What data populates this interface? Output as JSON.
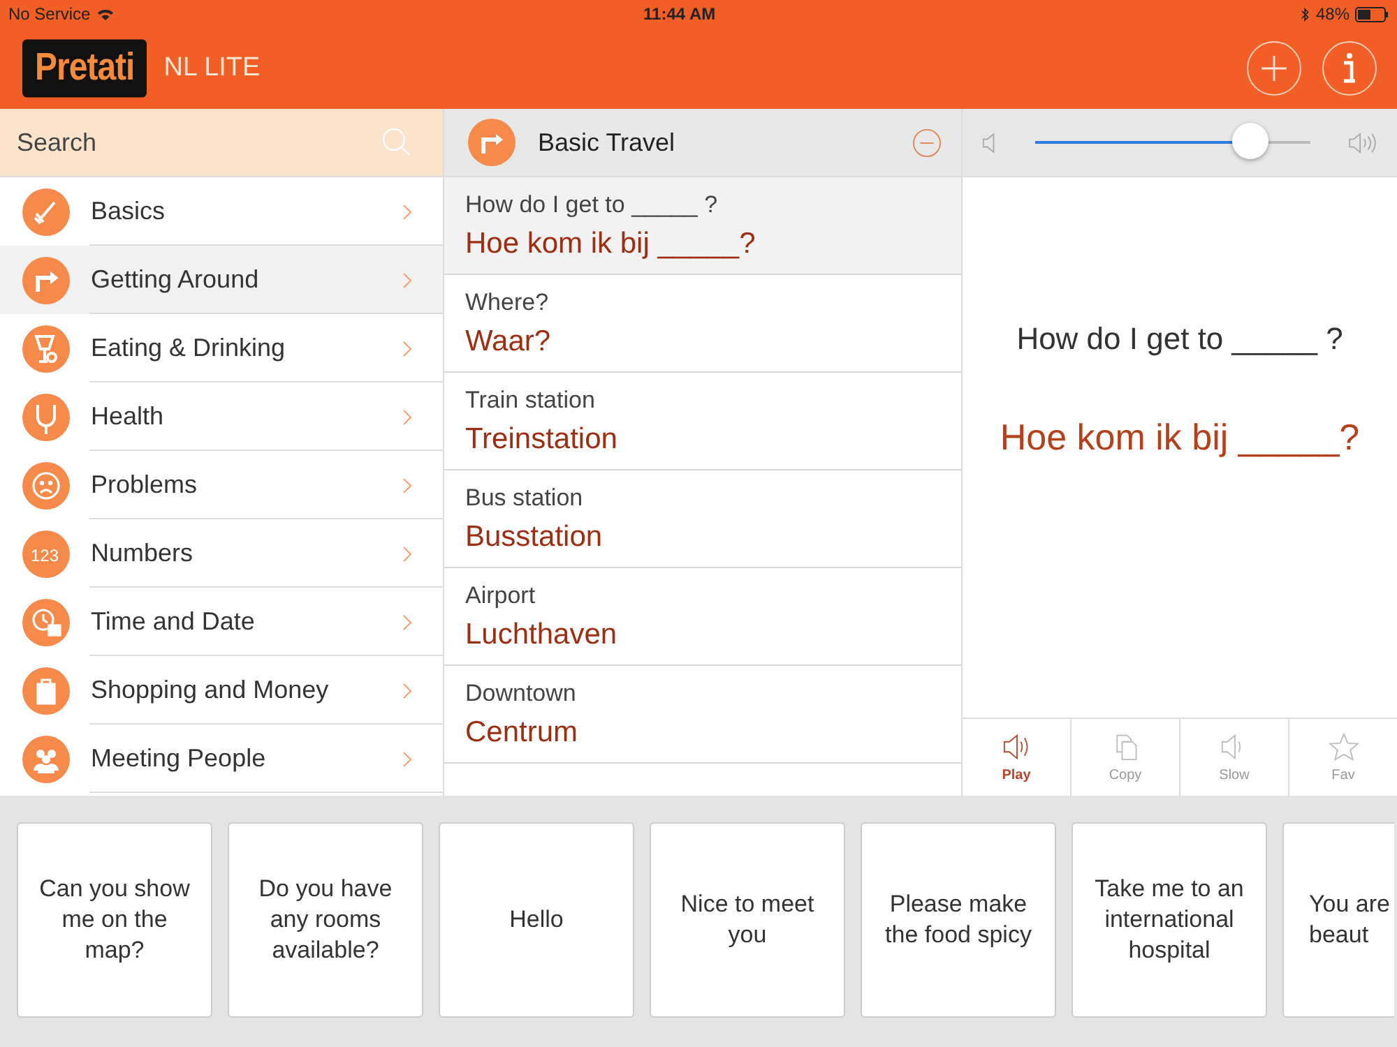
{
  "status_bar": {
    "carrier": "No Service",
    "time": "11:44 AM",
    "battery": "48%"
  },
  "header": {
    "logo": "Pretati",
    "edition": "NL LITE"
  },
  "search": {
    "placeholder": "Search"
  },
  "categories": [
    {
      "label": "Basics",
      "selected": false
    },
    {
      "label": "Getting Around",
      "selected": true
    },
    {
      "label": "Eating & Drinking",
      "selected": false
    },
    {
      "label": "Health",
      "selected": false
    },
    {
      "label": "Problems",
      "selected": false
    },
    {
      "label": "Numbers",
      "selected": false,
      "icon_text": "123"
    },
    {
      "label": "Time and Date",
      "selected": false
    },
    {
      "label": "Shopping and Money",
      "selected": false
    },
    {
      "label": "Meeting People",
      "selected": false
    }
  ],
  "section": {
    "title": "Basic Travel"
  },
  "phrases": [
    {
      "english": "How do I get to _____ ?",
      "dutch": "Hoe kom ik bij _____?",
      "selected": true
    },
    {
      "english": "Where?",
      "dutch": "Waar?",
      "selected": false
    },
    {
      "english": "Train station",
      "dutch": "Treinstation",
      "selected": false
    },
    {
      "english": "Bus station",
      "dutch": "Busstation",
      "selected": false
    },
    {
      "english": "Airport",
      "dutch": "Luchthaven",
      "selected": false
    },
    {
      "english": "Downtown",
      "dutch": "Centrum",
      "selected": false
    }
  ],
  "volume": {
    "level": 0.78
  },
  "display": {
    "english": "How do I get to _____ ?",
    "dutch": "Hoe kom ik bij _____?"
  },
  "actions": [
    {
      "label": "Play",
      "selected": true
    },
    {
      "label": "Copy",
      "selected": false
    },
    {
      "label": "Slow",
      "selected": false
    },
    {
      "label": "Fav",
      "selected": false
    }
  ],
  "favorites": [
    {
      "text": "Can you show me on the map?"
    },
    {
      "text": "Do you have any rooms available?"
    },
    {
      "text": "Hello"
    },
    {
      "text": "Nice to meet you"
    },
    {
      "text": "Please make the food spicy"
    },
    {
      "text": "Take me to an international hospital"
    },
    {
      "text": "You are beaut",
      "partial": true
    }
  ]
}
